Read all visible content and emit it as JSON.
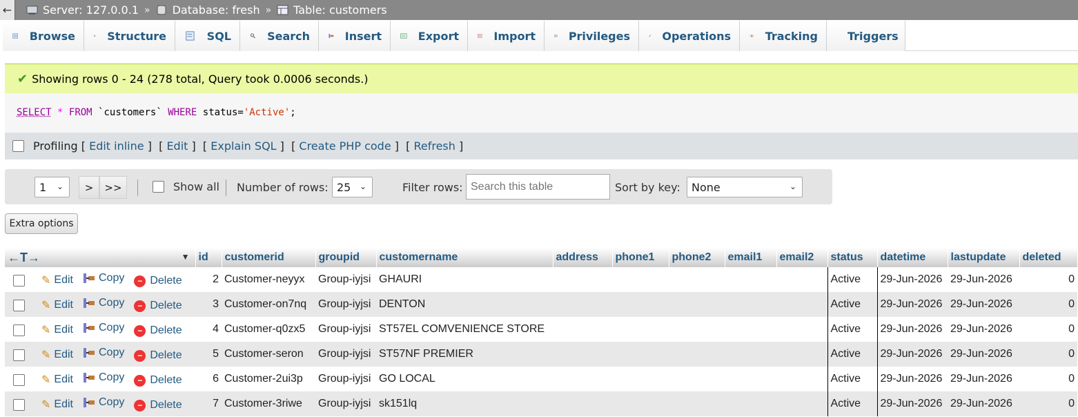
{
  "breadcrumb": {
    "back": "←",
    "server": "Server: 127.0.0.1",
    "database": "Database: fresh",
    "table": "Table: customers",
    "separator": "»"
  },
  "tabs": [
    {
      "label": "Browse",
      "icon": "browse-icon"
    },
    {
      "label": "Structure",
      "icon": "structure-icon"
    },
    {
      "label": "SQL",
      "icon": "sql-icon"
    },
    {
      "label": "Search",
      "icon": "search-icon"
    },
    {
      "label": "Insert",
      "icon": "insert-icon"
    },
    {
      "label": "Export",
      "icon": "export-icon"
    },
    {
      "label": "Import",
      "icon": "import-icon"
    },
    {
      "label": "Privileges",
      "icon": "privileges-icon"
    },
    {
      "label": "Operations",
      "icon": "wrench-icon"
    },
    {
      "label": "Tracking",
      "icon": "eye-icon"
    },
    {
      "label": "Triggers",
      "icon": "triggers-icon"
    }
  ],
  "message": "Showing rows 0 - 24 (278 total, Query took 0.0006 seconds.)",
  "sql": {
    "select": "SELECT",
    "star": "*",
    "from": "FROM",
    "table": "`customers`",
    "where": "WHERE",
    "col": "status=",
    "value": "'Active'",
    "end": ";"
  },
  "profiling": {
    "label": "Profiling",
    "links": [
      "Edit inline",
      "Edit",
      "Explain SQL",
      "Create PHP code",
      "Refresh"
    ]
  },
  "nav": {
    "page": "1",
    "next": ">",
    "last": ">>",
    "show_all": "Show all",
    "rows_label": "Number of rows:",
    "rows_value": "25",
    "filter_label": "Filter rows:",
    "filter_placeholder": "Search this table",
    "sort_label": "Sort by key:",
    "sort_value": "None"
  },
  "extra_options": "Extra options",
  "table": {
    "columns": [
      "id",
      "customerid",
      "groupid",
      "customername",
      "address",
      "phone1",
      "phone2",
      "email1",
      "email2",
      "status",
      "datetime",
      "lastupdate",
      "deleted"
    ],
    "actions": {
      "edit": "Edit",
      "copy": "Copy",
      "delete": "Delete"
    },
    "rows": [
      [
        "2",
        "Customer-neyyx",
        "Group-iyjsi",
        "GHAURI",
        "",
        "",
        "",
        "",
        "",
        "Active",
        "29-Jun-2026",
        "29-Jun-2026",
        "0"
      ],
      [
        "3",
        "Customer-on7nq",
        "Group-iyjsi",
        "DENTON",
        "",
        "",
        "",
        "",
        "",
        "Active",
        "29-Jun-2026",
        "29-Jun-2026",
        "0"
      ],
      [
        "4",
        "Customer-q0zx5",
        "Group-iyjsi",
        "ST57EL COMVENIENCE STORE",
        "",
        "",
        "",
        "",
        "",
        "Active",
        "29-Jun-2026",
        "29-Jun-2026",
        "0"
      ],
      [
        "5",
        "Customer-seron",
        "Group-iyjsi",
        "ST57NF PREMIER",
        "",
        "",
        "",
        "",
        "",
        "Active",
        "29-Jun-2026",
        "29-Jun-2026",
        "0"
      ],
      [
        "6",
        "Customer-2ui3p",
        "Group-iyjsi",
        "GO LOCAL",
        "",
        "",
        "",
        "",
        "",
        "Active",
        "29-Jun-2026",
        "29-Jun-2026",
        "0"
      ],
      [
        "7",
        "Customer-3riwe",
        "Group-iyjsi",
        "sk151lq",
        "",
        "",
        "",
        "",
        "",
        "Active",
        "29-Jun-2026",
        "29-Jun-2026",
        "0"
      ]
    ]
  },
  "colors": {
    "link": "#235a81",
    "success_bg": "#ebf8a4",
    "topbar_bg": "#888888",
    "row_alt": "#e8e8e8"
  }
}
